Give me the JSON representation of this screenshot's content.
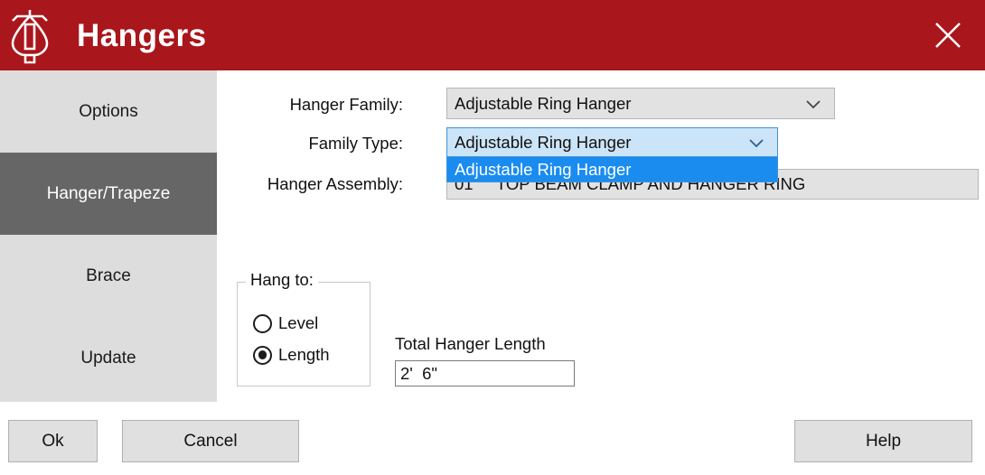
{
  "window": {
    "title": "Hangers",
    "logo_icon": "hanger-trapeze-logo-icon",
    "close_icon": "close-icon",
    "title_bar_color": "#a9161b"
  },
  "sidebar": {
    "items": [
      {
        "label": "Options",
        "selected": false
      },
      {
        "label": "Hanger/Trapeze",
        "selected": true
      },
      {
        "label": "Brace",
        "selected": false
      },
      {
        "label": "Update",
        "selected": false
      }
    ],
    "selected_color": "#666666",
    "background_color": "#dddddd"
  },
  "form": {
    "hanger_family": {
      "label": "Hanger Family:",
      "value": "Adjustable Ring Hanger",
      "chevron_icon": "chevron-down-icon"
    },
    "family_type": {
      "label": "Family Type:",
      "value": "Adjustable Ring Hanger",
      "chevron_icon": "chevron-down-icon",
      "expanded": true,
      "options": [
        {
          "label": "Adjustable Ring Hanger",
          "highlighted": true
        }
      ],
      "highlight_color": "#1a8cf0",
      "field_color": "#cce4f7"
    },
    "hanger_assembly": {
      "label": "Hanger Assembly:",
      "value": "01     TOP BEAM CLAMP AND HANGER RING"
    }
  },
  "hang_to": {
    "legend": "Hang to:",
    "options": [
      {
        "label": "Level",
        "checked": false
      },
      {
        "label": "Length",
        "checked": true
      }
    ]
  },
  "total_hanger_length": {
    "label": "Total Hanger Length",
    "value": "2'  6\"",
    "placeholder": ""
  },
  "footer": {
    "ok_label": "Ok",
    "cancel_label": "Cancel",
    "help_label": "Help"
  }
}
